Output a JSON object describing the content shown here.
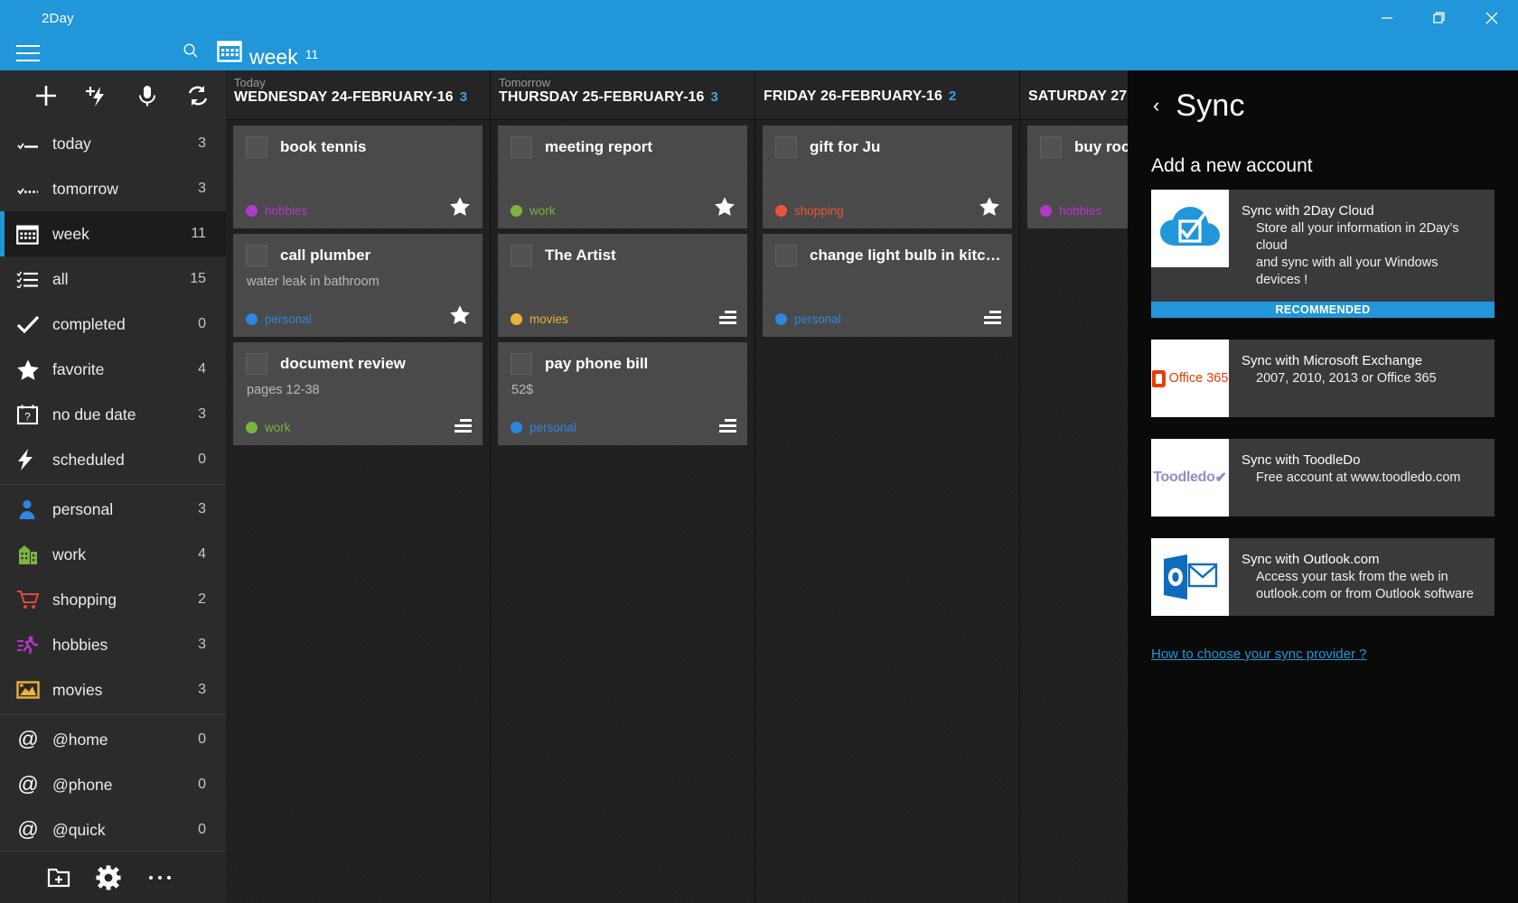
{
  "window": {
    "app_title": "2Day",
    "minimize_label": "Minimize",
    "maximize_label": "Restore",
    "close_label": "Close"
  },
  "commandbar": {
    "menu_label": "Menu",
    "search_label": "Search",
    "view_icon": "calendar-icon",
    "view_name": "week",
    "view_count": "11"
  },
  "side_actions": [
    {
      "name": "add-task-button",
      "icon": "plus-icon"
    },
    {
      "name": "quick-add-button",
      "icon": "plus-bolt-icon"
    },
    {
      "name": "voice-add-button",
      "icon": "microphone-icon"
    },
    {
      "name": "sync-button",
      "icon": "refresh-icon"
    }
  ],
  "sidebar": {
    "items": [
      {
        "label": "today",
        "count": "3",
        "icon": "today-icon",
        "color": "#ffffff",
        "selected": false
      },
      {
        "label": "tomorrow",
        "count": "3",
        "icon": "tomorrow-icon",
        "color": "#ffffff",
        "selected": false
      },
      {
        "label": "week",
        "count": "11",
        "icon": "calendar-icon",
        "color": "#ffffff",
        "selected": true
      },
      {
        "label": "all",
        "count": "15",
        "icon": "list-icon",
        "color": "#ffffff",
        "selected": false
      },
      {
        "label": "completed",
        "count": "0",
        "icon": "check-icon",
        "color": "#ffffff",
        "selected": false
      },
      {
        "label": "favorite",
        "count": "4",
        "icon": "star-icon",
        "color": "#ffffff",
        "selected": false
      },
      {
        "label": "no due date",
        "count": "3",
        "icon": "calendar-question-icon",
        "color": "#ffffff",
        "selected": false
      },
      {
        "label": "scheduled",
        "count": "0",
        "icon": "bolt-icon",
        "color": "#ffffff",
        "selected": false
      },
      {
        "label": "personal",
        "count": "3",
        "icon": "person-icon",
        "color": "#2e86de",
        "selected": false
      },
      {
        "label": "work",
        "count": "4",
        "icon": "building-icon",
        "color": "#7cb342",
        "selected": false
      },
      {
        "label": "shopping",
        "count": "2",
        "icon": "cart-icon",
        "color": "#e04a3a",
        "selected": false
      },
      {
        "label": "hobbies",
        "count": "3",
        "icon": "running-icon",
        "color": "#b138c8",
        "selected": false
      },
      {
        "label": "movies",
        "count": "3",
        "icon": "picture-icon",
        "color": "#e8b339",
        "selected": false
      },
      {
        "label": "@home",
        "count": "0",
        "icon": "at-icon",
        "color": "#ffffff",
        "selected": false
      },
      {
        "label": "@phone",
        "count": "0",
        "icon": "at-icon",
        "color": "#ffffff",
        "selected": false
      },
      {
        "label": "@quick",
        "count": "0",
        "icon": "at-icon",
        "color": "#ffffff",
        "selected": false
      }
    ],
    "separators_after": [
      7,
      12
    ],
    "bottom_buttons": [
      {
        "name": "new-folder-button",
        "icon": "folder-plus-icon"
      },
      {
        "name": "settings-button",
        "icon": "gear-icon"
      },
      {
        "name": "more-button",
        "icon": "ellipsis-icon"
      }
    ]
  },
  "agenda": {
    "columns": [
      {
        "relative": "Today",
        "date": "WEDNESDAY 24-FEBRUARY-16",
        "count": "3",
        "tasks": [
          {
            "title": "book tennis",
            "note": "",
            "tag": "hobbies",
            "tag_color": "#b138c8",
            "favorite": true,
            "has_notes": false
          },
          {
            "title": "call plumber",
            "note": "water leak in bathroom",
            "tag": "personal",
            "tag_color": "#2e86de",
            "favorite": true,
            "has_notes": false
          },
          {
            "title": "document review",
            "note": "pages 12-38",
            "tag": "work",
            "tag_color": "#7cb342",
            "favorite": false,
            "has_notes": true
          }
        ]
      },
      {
        "relative": "Tomorrow",
        "date": "THURSDAY 25-FEBRUARY-16",
        "count": "3",
        "tasks": [
          {
            "title": "meeting report",
            "note": "",
            "tag": "work",
            "tag_color": "#7cb342",
            "favorite": true,
            "has_notes": false
          },
          {
            "title": "The Artist",
            "note": "",
            "tag": "movies",
            "tag_color": "#e8b339",
            "favorite": false,
            "has_notes": true
          },
          {
            "title": "pay phone bill",
            "note": "52$",
            "tag": "personal",
            "tag_color": "#2e86de",
            "favorite": false,
            "has_notes": true
          }
        ]
      },
      {
        "relative": "",
        "date": "FRIDAY 26-FEBRUARY-16",
        "count": "2",
        "tasks": [
          {
            "title": "gift for Ju",
            "note": "",
            "tag": "shopping",
            "tag_color": "#e8563a",
            "favorite": true,
            "has_notes": false
          },
          {
            "title": "change light bulb in kitchen",
            "note": "",
            "tag": "personal",
            "tag_color": "#2e86de",
            "favorite": false,
            "has_notes": true
          }
        ]
      },
      {
        "relative": "",
        "date": "SATURDAY 27",
        "count": "",
        "tasks": [
          {
            "title": "buy roc",
            "note": "",
            "tag": "hobbies",
            "tag_color": "#b138c8",
            "favorite": false,
            "has_notes": false
          }
        ]
      }
    ]
  },
  "sync": {
    "back_label": "‹",
    "title": "Sync",
    "subtitle": "Add a new account",
    "accounts": [
      {
        "logo": "cloud-check-icon",
        "line1": "Sync with 2Day Cloud",
        "line2": "Store all your information in 2Day’s cloud",
        "line3": "and sync with all your Windows devices !",
        "badge": "RECOMMENDED"
      },
      {
        "logo": "office365-icon",
        "line1": "Sync with Microsoft Exchange",
        "line2": "2007, 2010, 2013 or Office 365",
        "line3": "",
        "badge": ""
      },
      {
        "logo": "toodledo-icon",
        "line1": "Sync with ToodleDo",
        "line2": "Free account at www.toodledo.com",
        "line3": "",
        "badge": ""
      },
      {
        "logo": "outlook-icon",
        "line1": "Sync with Outlook.com",
        "line2": "Access your task from the web in",
        "line3": "outlook.com or from Outlook software",
        "badge": ""
      }
    ],
    "help_link": "How to choose your sync provider ?",
    "logo_labels": {
      "office365": "Office 365",
      "toodledo": "Toodledo"
    }
  },
  "colors": {
    "accent": "#2196d8",
    "sidebar_bg": "#2b2b2b",
    "card_bg": "#4a4a4a",
    "panel_bg": "#0a0a0a"
  }
}
